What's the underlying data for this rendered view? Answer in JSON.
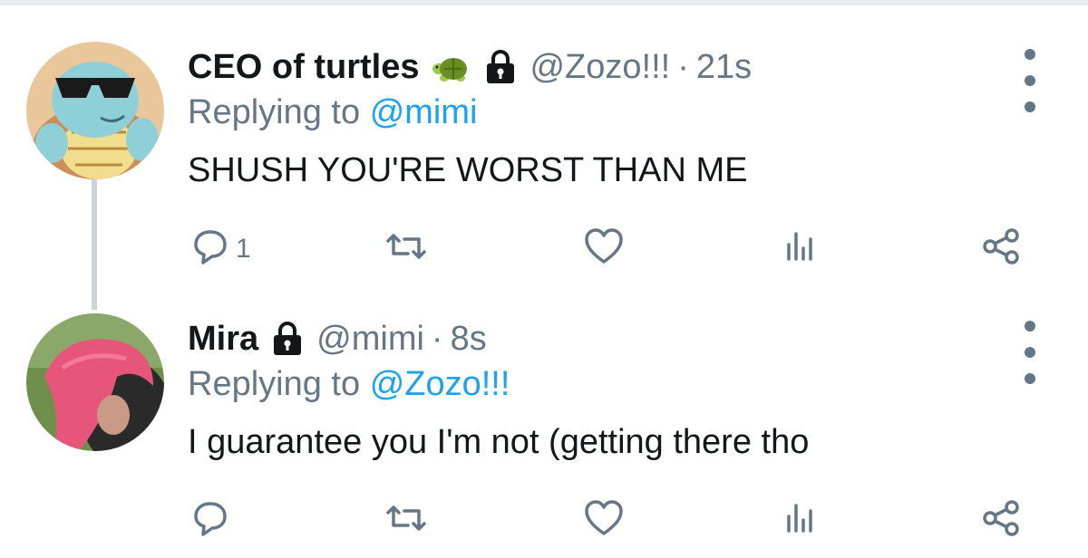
{
  "colors": {
    "text": "#14171a",
    "secondary": "#657786",
    "accent": "#1da1f2",
    "divider": "#e6ecf0",
    "thread_line": "#ccd6dd"
  },
  "tweets": [
    {
      "display_name": "CEO of turtles",
      "name_emoji": "turtle-emoji",
      "protected": true,
      "handle": "@Zozo!!!",
      "separator": "·",
      "time": "21s",
      "replying_label": "Replying to",
      "replying_to": "@mimi",
      "text": "SHUSH YOU'RE WORST THAN ME",
      "reply_count": "1",
      "avatar": "squirtle-sunglasses-avatar",
      "icons": [
        "reply-icon",
        "retweet-icon",
        "like-icon",
        "stats-icon",
        "share-icon",
        "more-options-icon"
      ]
    },
    {
      "display_name": "Mira",
      "protected": true,
      "handle": "@mimi",
      "separator": "·",
      "time": "8s",
      "replying_label": "Replying to",
      "replying_to": "@Zozo!!!",
      "text": "I guarantee you I'm not (getting there tho",
      "reply_count": "",
      "avatar": "pink-hair-photo-avatar",
      "icons": [
        "reply-icon",
        "retweet-icon",
        "like-icon",
        "stats-icon",
        "share-icon",
        "more-options-icon"
      ]
    }
  ]
}
